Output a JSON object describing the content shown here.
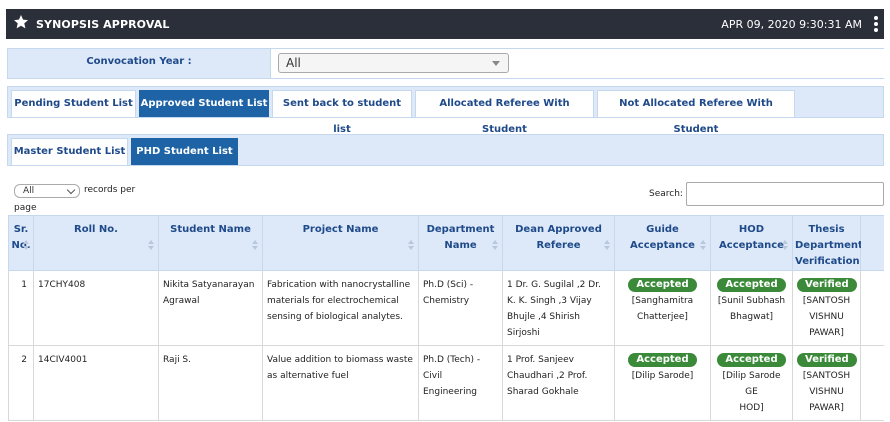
{
  "header": {
    "title": "SYNOPSIS APPROVAL",
    "datetime": "APR 09, 2020  9:30:31 AM"
  },
  "filter": {
    "label": "Convocation Year :",
    "selected": "All"
  },
  "tabs_main": [
    {
      "label": "Pending Student List",
      "active": false
    },
    {
      "label": "Approved Student List",
      "active": true
    },
    {
      "label": "Sent back to student list",
      "active": false
    },
    {
      "label": "Allocated Referee With Student",
      "active": false
    },
    {
      "label": "Not Allocated Referee With Student",
      "active": false
    }
  ],
  "tabs_sub": [
    {
      "label": "Master Student List",
      "active": false
    },
    {
      "label": "PHD Student List",
      "active": true
    }
  ],
  "length": {
    "selected": "All",
    "text_a": "records per",
    "text_b": "page"
  },
  "search": {
    "label": "Search:",
    "value": ""
  },
  "table": {
    "headers": [
      [
        "Sr.",
        "No."
      ],
      [
        "Roll No."
      ],
      [
        "Student Name"
      ],
      [
        "Project Name"
      ],
      [
        "Department",
        "Name"
      ],
      [
        "Dean Approved",
        "Referee"
      ],
      [
        "Guide Acceptance"
      ],
      [
        "HOD",
        "Acceptance"
      ],
      [
        "Thesis",
        "Department",
        "Verification"
      ]
    ],
    "rows": [
      {
        "sr": "1",
        "roll": "17CHY408",
        "name": [
          "Nikita Satyanarayan",
          "Agrawal"
        ],
        "project": [
          "Fabrication with nanocrystalline",
          "materials for electrochemical",
          "sensing of biological analytes."
        ],
        "department": [
          "Ph.D (Sci) -",
          "Chemistry"
        ],
        "referee": [
          "1 Dr. G. Sugilal ,2 Dr.",
          "K. K. Singh ,3 Vijay",
          "Bhujle ,4 Shirish",
          "Sirjoshi"
        ],
        "guide_badge": "Accepted",
        "guide_name": [
          "[Sanghamitra",
          "Chatterjee]"
        ],
        "hod_badge": "Accepted",
        "hod_name": [
          "[Sunil Subhash",
          "Bhagwat]"
        ],
        "thesis_badge": "Verified",
        "thesis_name": [
          "[SANTOSH",
          "VISHNU",
          "PAWAR]"
        ]
      },
      {
        "sr": "2",
        "roll": "14CIV4001",
        "name": [
          "Raji S."
        ],
        "project": [
          "Value addition to biomass waste",
          "as alternative fuel"
        ],
        "department": [
          "Ph.D (Tech) -",
          "Civil",
          "Engineering"
        ],
        "referee": [
          "1 Prof. Sanjeev",
          "Chaudhari ,2 Prof.",
          "Sharad Gokhale"
        ],
        "guide_badge": "Accepted",
        "guide_name": [
          "[Dilip Sarode]"
        ],
        "hod_badge": "Accepted",
        "hod_name": [
          "[Dilip Sarode GE",
          "HOD]"
        ],
        "thesis_badge": "Verified",
        "thesis_name": [
          "[SANTOSH",
          "VISHNU",
          "PAWAR]"
        ]
      }
    ]
  },
  "colors": {
    "topbar": "#2b2f3a",
    "tab_active": "#1e63a6",
    "panel": "#dde9f8",
    "badge": "#3a8a3a"
  }
}
